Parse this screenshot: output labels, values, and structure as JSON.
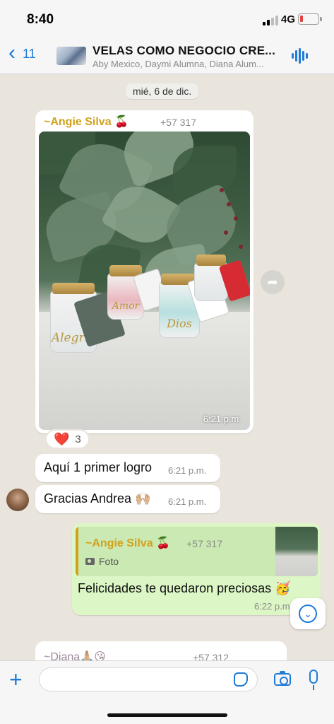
{
  "status_bar": {
    "time": "8:40",
    "network": "4G"
  },
  "header": {
    "back_count": "11",
    "title": "VELAS COMO NEGOCIO CRE...",
    "subtitle": "Aby Mexico, Daymi Alumna, Diana Alum..."
  },
  "chat": {
    "date_chip": "mié, 6 de dic.",
    "photo_message": {
      "sender": "~Angie Silva 🍒",
      "phone": "+57 317",
      "time": "6:21 p.m.",
      "jar_words": [
        "Alegría",
        "Amor",
        "Dios",
        ""
      ],
      "reaction_emoji": "❤️",
      "reaction_count": "3"
    },
    "text_message_1": {
      "text": "Aquí 1 primer logro",
      "time": "6:21 p.m."
    },
    "text_message_2": {
      "text": "Gracias Andrea 🙌🏼",
      "time": "6:21 p.m."
    },
    "reply_message": {
      "quoted_sender": "~Angie Silva 🍒",
      "quoted_phone": "+57 317",
      "quoted_type": "Foto",
      "text": "Felicidades te quedaron preciosas 🥳",
      "time": "6:22 p.m."
    },
    "partial_message": {
      "sender": "~Diana🙏🏼😘",
      "phone": "+57 312"
    }
  },
  "input": {
    "placeholder": ""
  },
  "icons": {
    "back": "chevron-left-icon",
    "voice_chat": "audio-wave-icon",
    "forward": "forward-icon",
    "scroll_down": "chevron-down-icon",
    "attach": "plus-icon",
    "sticker": "sticker-icon",
    "camera": "camera-icon",
    "mic": "microphone-icon"
  },
  "colors": {
    "accent": "#1f7bd8",
    "sender_name": "#d1a11d",
    "outgoing_bubble": "#dcf7c5",
    "chat_background": "#e9e4dc"
  }
}
